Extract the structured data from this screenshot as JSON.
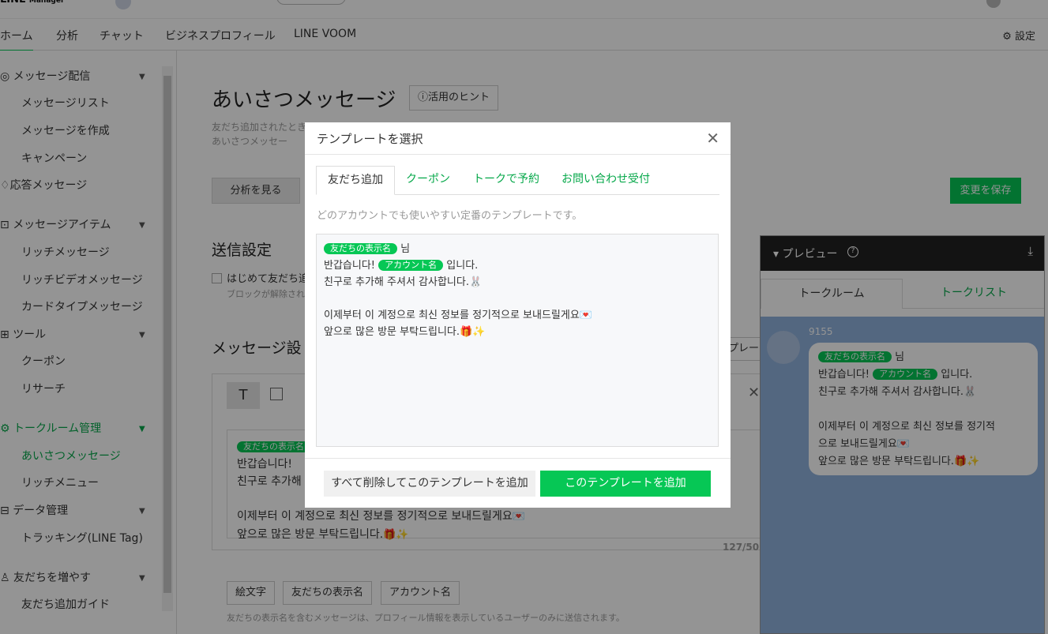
{
  "nav": {
    "tabs": [
      "ホーム",
      "分析",
      "チャット",
      "ビジネスプロフィール",
      "LINE VOOM"
    ],
    "settings": "設定"
  },
  "sidebar": {
    "items": [
      "メッセージ配信",
      "メッセージリスト",
      "メッセージを作成",
      "キャンペーン",
      "応答メッセージ",
      "メッセージアイテム",
      "リッチメッセージ",
      "リッチビデオメッセージ",
      "カードタイプメッセージ",
      "ツール",
      "クーポン",
      "リサーチ",
      "トークルーム管理",
      "あいさつメッセージ",
      "リッチメニュー",
      "データ管理",
      "トラッキング(LINE Tag)",
      "友だちを増やす",
      "友だち追加ガイド"
    ]
  },
  "main": {
    "title": "あいさつメッセージ",
    "hint_button": "活用のヒント",
    "desc1": "友だち追加されたとき",
    "desc2": "あいさつメッセー",
    "analyze_button": "分析を見る",
    "save_button": "変更を保存",
    "send_settings": "送信設定",
    "checkbox_label": "はじめて友だち追",
    "checkbox_sub": "ブロックが解除され",
    "message_settings": "メッセージ設",
    "template_button_peek": "プレー",
    "editor_lines": [
      "반갑습니다!",
      "친구로 추가해",
      "",
      "이제부터 이 계정으로 최신 정보를 정기적으로 보내드릴게요",
      "앞으로 많은 방문 부탁드립니다."
    ],
    "char_count": "127/50",
    "chips": [
      "絵文字",
      "友だちの表示名",
      "アカウント名"
    ],
    "footnote": "友だちの表示名を含むメッセージは、プロフィール情報を表示しているユーザーのみに送信されます。"
  },
  "preview": {
    "title": "プレビュー",
    "tabs": [
      "トークルーム",
      "トークリスト"
    ],
    "sender": "9155"
  },
  "tags": {
    "friend_name": "友だちの表示名",
    "account_name": "アカウント名"
  },
  "modal": {
    "title": "テンプレートを選択",
    "tabs": [
      "友だち追加",
      "クーポン",
      "トークで予約",
      "お問い合わせ受付"
    ],
    "description": "どのアカウントでも使いやすい定番のテンプレートです。",
    "lines": {
      "l1_suffix": "님",
      "l2_prefix": "반갑습니다!",
      "l2_suffix": "입니다.",
      "l3": "친구로 추가해 주셔서 감사합니다.",
      "l5": "이제부터 이 계정으로 최신 정보를 정기적으로 보내드릴게요",
      "l6": "앞으로 많은 방문 부탁드립니다."
    },
    "preview_lines": {
      "l5a": "이제부터 이 계정으로 최신 정보를 정기적",
      "l5b": "으로 보내드릴게요"
    },
    "delete_add_button": "すべて削除してこのテンプレートを追加",
    "add_button": "このテンプレートを追加"
  },
  "colors": {
    "accent": "#06c755",
    "overlay": "rgba(0,0,0,0.42)"
  }
}
